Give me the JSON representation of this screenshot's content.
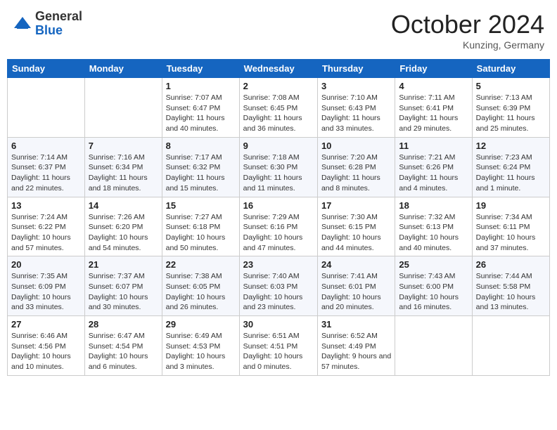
{
  "header": {
    "logo": {
      "general": "General",
      "blue": "Blue"
    },
    "title": "October 2024",
    "location": "Kunzing, Germany"
  },
  "weekdays": [
    "Sunday",
    "Monday",
    "Tuesday",
    "Wednesday",
    "Thursday",
    "Friday",
    "Saturday"
  ],
  "weeks": [
    [
      {
        "day": "",
        "info": ""
      },
      {
        "day": "",
        "info": ""
      },
      {
        "day": "1",
        "info": "Sunrise: 7:07 AM\nSunset: 6:47 PM\nDaylight: 11 hours and 40 minutes."
      },
      {
        "day": "2",
        "info": "Sunrise: 7:08 AM\nSunset: 6:45 PM\nDaylight: 11 hours and 36 minutes."
      },
      {
        "day": "3",
        "info": "Sunrise: 7:10 AM\nSunset: 6:43 PM\nDaylight: 11 hours and 33 minutes."
      },
      {
        "day": "4",
        "info": "Sunrise: 7:11 AM\nSunset: 6:41 PM\nDaylight: 11 hours and 29 minutes."
      },
      {
        "day": "5",
        "info": "Sunrise: 7:13 AM\nSunset: 6:39 PM\nDaylight: 11 hours and 25 minutes."
      }
    ],
    [
      {
        "day": "6",
        "info": "Sunrise: 7:14 AM\nSunset: 6:37 PM\nDaylight: 11 hours and 22 minutes."
      },
      {
        "day": "7",
        "info": "Sunrise: 7:16 AM\nSunset: 6:34 PM\nDaylight: 11 hours and 18 minutes."
      },
      {
        "day": "8",
        "info": "Sunrise: 7:17 AM\nSunset: 6:32 PM\nDaylight: 11 hours and 15 minutes."
      },
      {
        "day": "9",
        "info": "Sunrise: 7:18 AM\nSunset: 6:30 PM\nDaylight: 11 hours and 11 minutes."
      },
      {
        "day": "10",
        "info": "Sunrise: 7:20 AM\nSunset: 6:28 PM\nDaylight: 11 hours and 8 minutes."
      },
      {
        "day": "11",
        "info": "Sunrise: 7:21 AM\nSunset: 6:26 PM\nDaylight: 11 hours and 4 minutes."
      },
      {
        "day": "12",
        "info": "Sunrise: 7:23 AM\nSunset: 6:24 PM\nDaylight: 11 hours and 1 minute."
      }
    ],
    [
      {
        "day": "13",
        "info": "Sunrise: 7:24 AM\nSunset: 6:22 PM\nDaylight: 10 hours and 57 minutes."
      },
      {
        "day": "14",
        "info": "Sunrise: 7:26 AM\nSunset: 6:20 PM\nDaylight: 10 hours and 54 minutes."
      },
      {
        "day": "15",
        "info": "Sunrise: 7:27 AM\nSunset: 6:18 PM\nDaylight: 10 hours and 50 minutes."
      },
      {
        "day": "16",
        "info": "Sunrise: 7:29 AM\nSunset: 6:16 PM\nDaylight: 10 hours and 47 minutes."
      },
      {
        "day": "17",
        "info": "Sunrise: 7:30 AM\nSunset: 6:15 PM\nDaylight: 10 hours and 44 minutes."
      },
      {
        "day": "18",
        "info": "Sunrise: 7:32 AM\nSunset: 6:13 PM\nDaylight: 10 hours and 40 minutes."
      },
      {
        "day": "19",
        "info": "Sunrise: 7:34 AM\nSunset: 6:11 PM\nDaylight: 10 hours and 37 minutes."
      }
    ],
    [
      {
        "day": "20",
        "info": "Sunrise: 7:35 AM\nSunset: 6:09 PM\nDaylight: 10 hours and 33 minutes."
      },
      {
        "day": "21",
        "info": "Sunrise: 7:37 AM\nSunset: 6:07 PM\nDaylight: 10 hours and 30 minutes."
      },
      {
        "day": "22",
        "info": "Sunrise: 7:38 AM\nSunset: 6:05 PM\nDaylight: 10 hours and 26 minutes."
      },
      {
        "day": "23",
        "info": "Sunrise: 7:40 AM\nSunset: 6:03 PM\nDaylight: 10 hours and 23 minutes."
      },
      {
        "day": "24",
        "info": "Sunrise: 7:41 AM\nSunset: 6:01 PM\nDaylight: 10 hours and 20 minutes."
      },
      {
        "day": "25",
        "info": "Sunrise: 7:43 AM\nSunset: 6:00 PM\nDaylight: 10 hours and 16 minutes."
      },
      {
        "day": "26",
        "info": "Sunrise: 7:44 AM\nSunset: 5:58 PM\nDaylight: 10 hours and 13 minutes."
      }
    ],
    [
      {
        "day": "27",
        "info": "Sunrise: 6:46 AM\nSunset: 4:56 PM\nDaylight: 10 hours and 10 minutes."
      },
      {
        "day": "28",
        "info": "Sunrise: 6:47 AM\nSunset: 4:54 PM\nDaylight: 10 hours and 6 minutes."
      },
      {
        "day": "29",
        "info": "Sunrise: 6:49 AM\nSunset: 4:53 PM\nDaylight: 10 hours and 3 minutes."
      },
      {
        "day": "30",
        "info": "Sunrise: 6:51 AM\nSunset: 4:51 PM\nDaylight: 10 hours and 0 minutes."
      },
      {
        "day": "31",
        "info": "Sunrise: 6:52 AM\nSunset: 4:49 PM\nDaylight: 9 hours and 57 minutes."
      },
      {
        "day": "",
        "info": ""
      },
      {
        "day": "",
        "info": ""
      }
    ]
  ]
}
